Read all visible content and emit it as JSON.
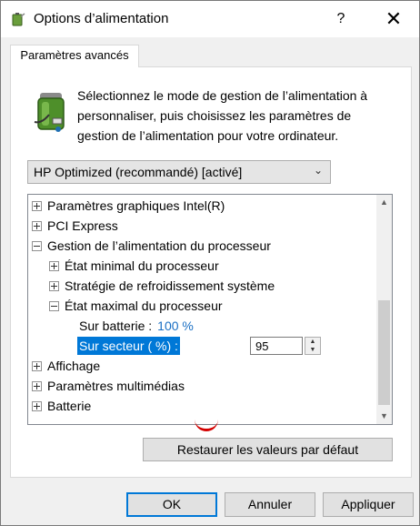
{
  "window": {
    "title": "Options d’alimentation",
    "help": "?",
    "close": "✕"
  },
  "tab": {
    "label": "Paramètres avancés"
  },
  "description": {
    "line1": "Sélectionnez le mode de gestion de l’alimentation à",
    "line2": "personnaliser, puis choisissez les paramètres de",
    "line3": "gestion de l’alimentation pour votre ordinateur."
  },
  "plan_select": {
    "selected": "HP Optimized (recommandé) [activé]"
  },
  "tree": {
    "items": [
      {
        "label": "Paramètres graphiques Intel(R)"
      },
      {
        "label": "PCI Express"
      },
      {
        "label": "Gestion de l’alimentation du processeur"
      },
      {
        "label": "État minimal du processeur"
      },
      {
        "label": "Stratégie de refroidissement système"
      },
      {
        "label": "État maximal du processeur"
      },
      {
        "label": "Affichage"
      },
      {
        "label": "Paramètres multimédias"
      },
      {
        "label": "Batterie"
      }
    ],
    "battery_setting": {
      "label": "Sur batterie :",
      "value": "100 %"
    },
    "ac_setting": {
      "label": "Sur secteur ( %) :",
      "value": "95"
    }
  },
  "buttons": {
    "restore": "Restaurer les valeurs par défaut",
    "ok": "OK",
    "cancel": "Annuler",
    "apply": "Appliquer"
  },
  "colors": {
    "accent": "#0078d7",
    "value_blue": "#1a6fc4",
    "annotation": "#d40000"
  }
}
